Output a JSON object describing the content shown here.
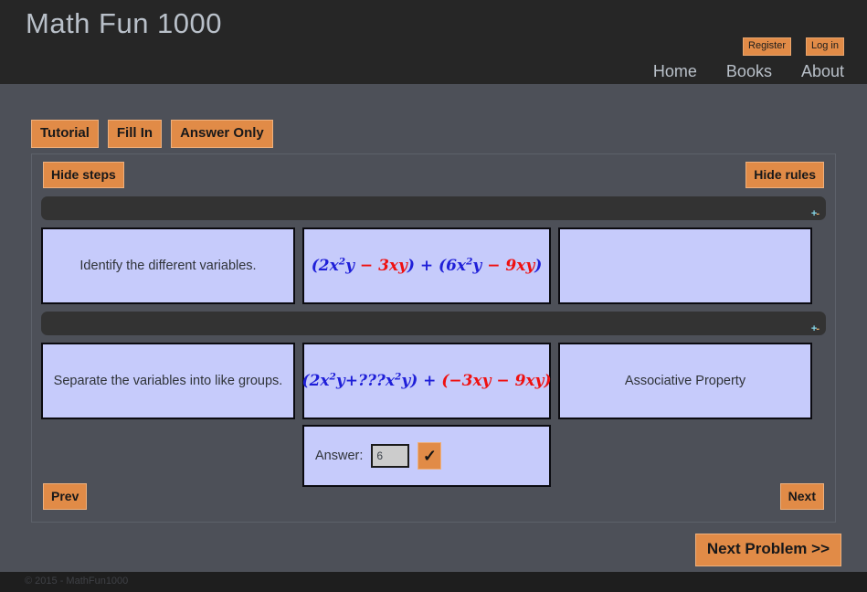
{
  "header": {
    "brand": "Math Fun 1000",
    "account": [
      {
        "label": "Register",
        "name": "register-button"
      },
      {
        "label": "Log in",
        "name": "login-button"
      }
    ],
    "nav": [
      {
        "label": "Home"
      },
      {
        "label": "Books"
      },
      {
        "label": "About"
      }
    ]
  },
  "modes": [
    {
      "label": "Tutorial"
    },
    {
      "label": "Fill In"
    },
    {
      "label": "Answer Only"
    }
  ],
  "panel": {
    "hide_steps_label": "Hide steps",
    "hide_rules_label": "Hide rules",
    "rulebar_plus": "+",
    "rulebar_minus": "-",
    "prev_label": "Prev",
    "next_label": "Next",
    "steps": [
      {
        "description": "Identify the different variables.",
        "rule": "",
        "expression": {
          "parts": [
            {
              "text": "(",
              "color": "blue",
              "sup": ""
            },
            {
              "text": "2x",
              "color": "blue",
              "sup": "2"
            },
            {
              "text": "y",
              "color": "blue",
              "sup": ""
            },
            {
              "text": " − ",
              "color": "red",
              "sup": ""
            },
            {
              "text": "3xy",
              "color": "red",
              "sup": ""
            },
            {
              "text": ")",
              "color": "blue",
              "sup": ""
            },
            {
              "text": " + ",
              "color": "blue",
              "sup": ""
            },
            {
              "text": "(",
              "color": "blue",
              "sup": ""
            },
            {
              "text": "6x",
              "color": "blue",
              "sup": "2"
            },
            {
              "text": "y",
              "color": "blue",
              "sup": ""
            },
            {
              "text": " − ",
              "color": "red",
              "sup": ""
            },
            {
              "text": "9xy",
              "color": "red",
              "sup": ""
            },
            {
              "text": ")",
              "color": "blue",
              "sup": ""
            }
          ]
        }
      },
      {
        "description": "Separate the variables into like groups.",
        "rule": "Associative Property",
        "expression": {
          "parts": [
            {
              "text": "(",
              "color": "blue",
              "sup": ""
            },
            {
              "text": "2x",
              "color": "blue",
              "sup": "2"
            },
            {
              "text": "y+???x",
              "color": "blue",
              "sup": "2"
            },
            {
              "text": "y",
              "color": "blue",
              "sup": ""
            },
            {
              "text": ")",
              "color": "blue",
              "sup": ""
            },
            {
              "text": " + ",
              "color": "blue",
              "sup": ""
            },
            {
              "text": "(",
              "color": "red",
              "sup": ""
            },
            {
              "text": "−3xy",
              "color": "red",
              "sup": ""
            },
            {
              "text": " − ",
              "color": "red",
              "sup": ""
            },
            {
              "text": "9xy",
              "color": "red",
              "sup": ""
            },
            {
              "text": ")",
              "color": "red",
              "sup": ""
            }
          ]
        }
      }
    ],
    "answer": {
      "label": "Answer:",
      "value": "6",
      "placeholder": "",
      "check_label": "✓"
    }
  },
  "next_problem_label": "Next Problem >>",
  "footer": {
    "text": "© 2015 - MathFun1000"
  },
  "colors": {
    "accent_orange": "#e18b47",
    "panel_bg": "#4d5058",
    "header_bg": "#262626",
    "cell_bg": "#c6cbfb",
    "math_blue": "#1f1fd8",
    "math_red": "#ef1010"
  }
}
